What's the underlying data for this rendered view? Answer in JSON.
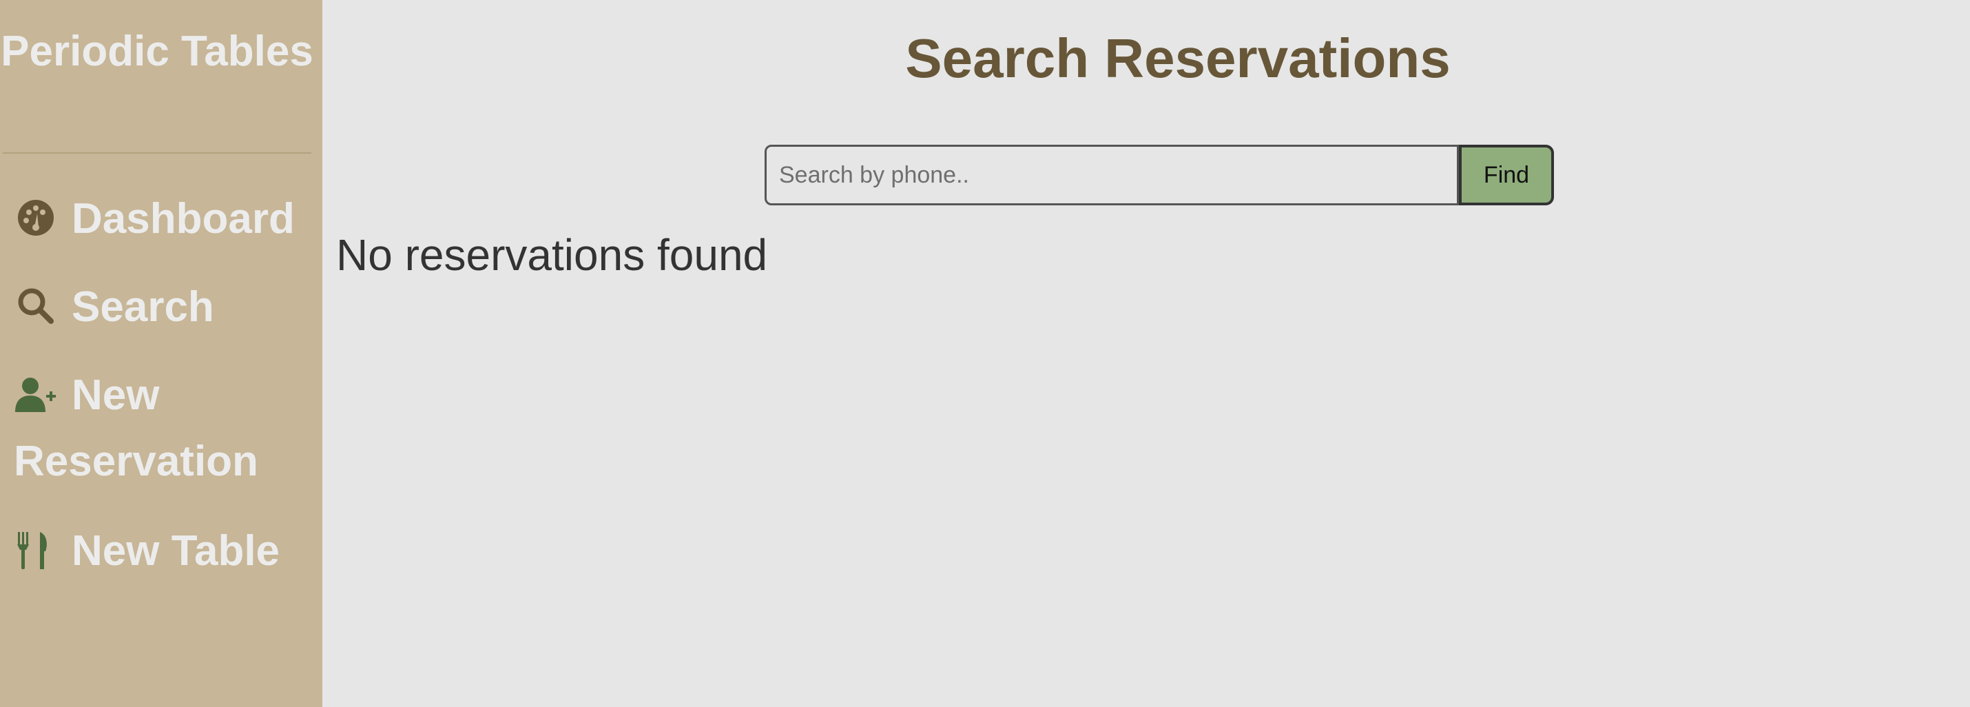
{
  "sidebar": {
    "brand": "Periodic Tables",
    "items": [
      {
        "label": "Dashboard",
        "icon": "dashboard-icon"
      },
      {
        "label": "Search",
        "icon": "search-icon"
      },
      {
        "label": "New Reservation",
        "icon": "user-plus-icon"
      },
      {
        "label": "New Table",
        "icon": "utensils-icon"
      }
    ]
  },
  "main": {
    "title": "Search Reservations",
    "search": {
      "placeholder": "Search by phone..",
      "value": "",
      "button_label": "Find"
    },
    "empty_message": "No reservations found"
  },
  "colors": {
    "sidebar_bg": "#c7b697",
    "page_bg": "#e6e6e6",
    "title": "#675738",
    "nav_text": "#ececec",
    "find_button": "#8fae7c",
    "icon_brown": "#675738",
    "icon_green": "#4a6a3e"
  }
}
